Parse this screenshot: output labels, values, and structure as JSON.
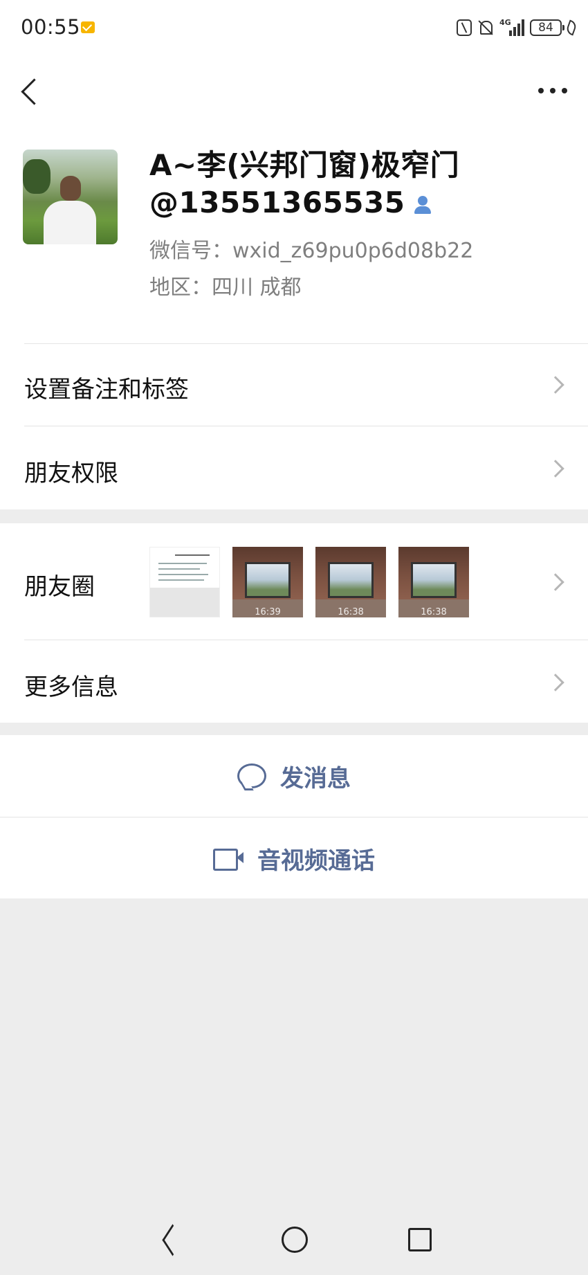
{
  "status_bar": {
    "time": "00:55",
    "network_label": "4G",
    "battery": "84",
    "icons": [
      "mail-notification-icon",
      "nfc-icon",
      "silent-bell-icon",
      "signal-icon",
      "battery-icon",
      "eco-leaf-icon"
    ]
  },
  "profile": {
    "name": "A~李(兴邦门窗)极窄门@13551365535",
    "wechat_id": "微信号：wxid_z69pu0p6d08b22",
    "region": "地区：四川  成都"
  },
  "menu": {
    "remark_tags": "设置备注和标签",
    "friend_permissions": "朋友权限",
    "moments": "朋友圈",
    "more_info": "更多信息"
  },
  "moments_thumbs": [
    {
      "type": "document",
      "time": ""
    },
    {
      "type": "room",
      "time": "16:39"
    },
    {
      "type": "room",
      "time": "16:38"
    },
    {
      "type": "room",
      "time": "16:38"
    }
  ],
  "actions": {
    "send_message": "发消息",
    "video_call": "音视频通话"
  },
  "colors": {
    "accent_link": "#576b95",
    "background": "#ededed",
    "badge_blue": "#5b8fd6"
  }
}
